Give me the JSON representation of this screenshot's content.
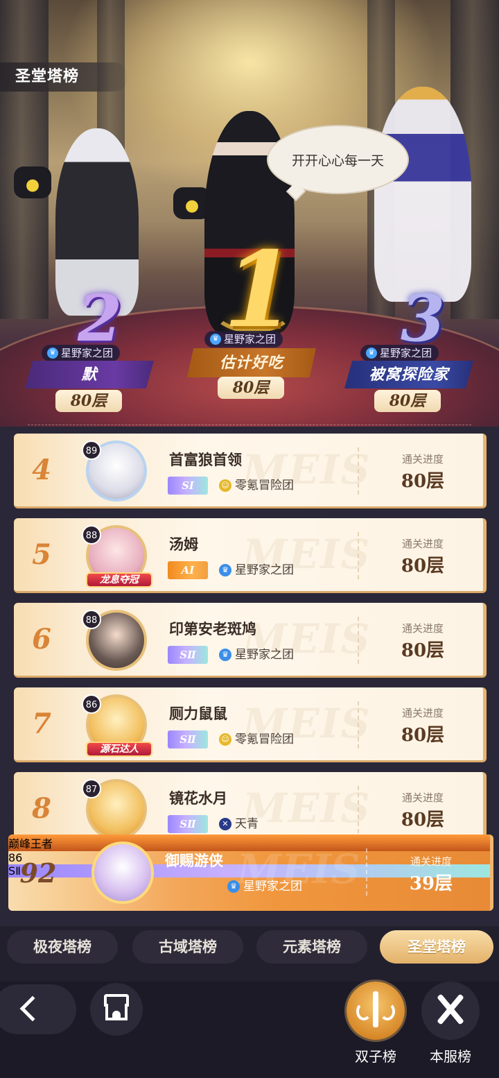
{
  "page_title": "圣堂塔榜",
  "speech_bubble": "开开心心每一天",
  "podium": [
    {
      "rank": "2",
      "guild": "星野家之团",
      "name": "默",
      "floor": "80层"
    },
    {
      "rank": "1",
      "guild": "星野家之团",
      "name": "估计好吃",
      "floor": "80层"
    },
    {
      "rank": "3",
      "guild": "星野家之团",
      "name": "被窝探险家",
      "floor": "80层"
    }
  ],
  "progress_label": "通关进度",
  "rows": [
    {
      "rank": "4",
      "level": "89",
      "name": "首富狼首领",
      "tier": "SⅠ",
      "guild": "零氪冒险团",
      "guild_icon": "coin-icon",
      "progress": "80层",
      "frame_label": ""
    },
    {
      "rank": "5",
      "level": "88",
      "name": "汤姆",
      "tier": "AⅠ",
      "guild": "星野家之团",
      "guild_icon": "crown-icon",
      "progress": "80层",
      "frame_label": "龙息夺冠"
    },
    {
      "rank": "6",
      "level": "88",
      "name": "印第安老斑鸠",
      "tier": "SⅡ",
      "guild": "星野家之团",
      "guild_icon": "crown-icon",
      "progress": "80层",
      "frame_label": ""
    },
    {
      "rank": "7",
      "level": "86",
      "name": "厕力鼠鼠",
      "tier": "SⅡ",
      "guild": "零氪冒险团",
      "guild_icon": "coin-icon",
      "progress": "80层",
      "frame_label": "源石达人"
    },
    {
      "rank": "8",
      "level": "87",
      "name": "镜花水月",
      "tier": "SⅡ",
      "guild": "天青",
      "guild_icon": "shield-icon",
      "progress": "80层",
      "frame_label": ""
    }
  ],
  "me": {
    "rank": "92",
    "level": "86",
    "name": "御赐游侠",
    "tier": "SⅡ",
    "guild": "星野家之团",
    "progress": "39层",
    "frame_label": "巅峰王者"
  },
  "tabs": [
    "极夜塔榜",
    "古域塔榜",
    "元素塔榜",
    "圣堂塔榜"
  ],
  "active_tab": "圣堂塔榜",
  "bottom": {
    "twin_label": "双子榜",
    "server_label": "本服榜"
  },
  "colors": {
    "accent": "#e3b26a",
    "rank_text": "#d98436",
    "row_bg": "#fff7ea",
    "me_bg": "#f0973e"
  }
}
